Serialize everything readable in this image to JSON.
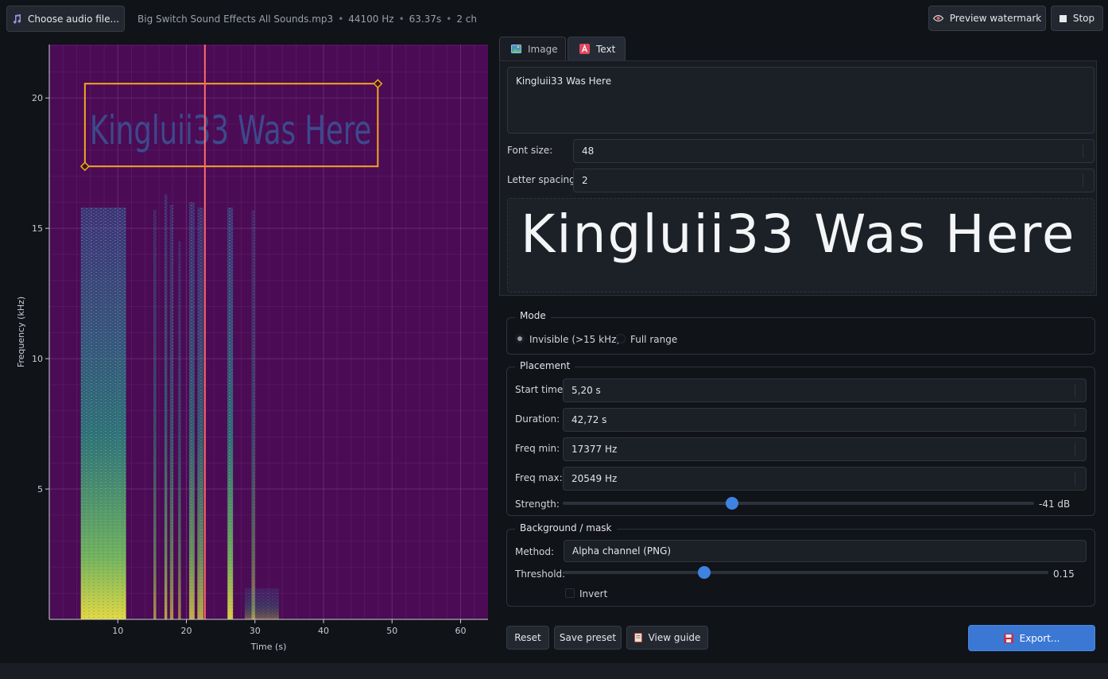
{
  "toolbar": {
    "choose_audio_label": "Choose audio file...",
    "file_name": "Big Switch Sound Effects All Sounds.mp3",
    "sample_rate": "44100 Hz",
    "duration": "63.37s",
    "channels": "2 ch",
    "separator": "•",
    "preview_label": "Preview watermark",
    "stop_label": "Stop"
  },
  "tabs": [
    {
      "label": "Image",
      "icon": "image-icon",
      "active": false
    },
    {
      "label": "Text",
      "icon": "text-icon",
      "active": true
    }
  ],
  "text_panel": {
    "watermark_text": "Kingluii33 Was Here",
    "font_size_label": "Font size:",
    "font_size_value": "48",
    "letter_spacing_label": "Letter spacing:",
    "letter_spacing_value": "2",
    "preview_text": "Kingluii33 Was Here"
  },
  "mode": {
    "title": "Mode",
    "options": [
      {
        "label": "Invisible (>15 kHz)",
        "selected": true
      },
      {
        "label": "Full range",
        "selected": false
      }
    ]
  },
  "placement": {
    "title": "Placement",
    "start_time_label": "Start time:",
    "start_time_value": "5,20 s",
    "duration_label": "Duration:",
    "duration_value": "42,72 s",
    "freq_min_label": "Freq min:",
    "freq_min_value": "17377 Hz",
    "freq_max_label": "Freq max:",
    "freq_max_value": "20549 Hz",
    "strength_label": "Strength:",
    "strength_value": "-41 dB",
    "strength_fraction": 0.36
  },
  "background": {
    "title": "Background / mask",
    "method_label": "Method:",
    "method_value": "Alpha channel (PNG)",
    "threshold_label": "Threshold:",
    "threshold_value": "0.15",
    "threshold_fraction": 0.29,
    "invert_label": "Invert",
    "invert_checked": false
  },
  "footer": {
    "reset_label": "Reset",
    "save_preset_label": "Save preset",
    "view_guide_label": "View guide",
    "export_label": "Export..."
  },
  "colors": {
    "accent": "#3a78d4",
    "spectrogram_bg": "#4b0b55",
    "playhead": "#ff6b6b",
    "selection": "#f5a623",
    "watermark_text": "#3c4a8c"
  },
  "chart_data": {
    "type": "heatmap",
    "title": "",
    "xlabel": "Time (s)",
    "ylabel": "Frequency (kHz)",
    "xlim": [
      0,
      64
    ],
    "ylim": [
      0,
      22.05
    ],
    "x_ticks": [
      10,
      20,
      30,
      40,
      50,
      60
    ],
    "y_ticks": [
      5,
      10,
      15,
      20
    ],
    "grid": true,
    "playhead_time": 22.7,
    "watermark_box": {
      "t_start": 5.2,
      "t_end": 47.92,
      "f_min": 17.377,
      "f_max": 20.549
    },
    "watermark_text": "Kingluii33 Was Here",
    "energy_bursts": [
      {
        "t_start": 4.6,
        "t_end": 11.2,
        "f_top": 15.8,
        "level": 0.95
      },
      {
        "t_start": 15.2,
        "t_end": 15.6,
        "f_top": 15.7,
        "level": 0.6
      },
      {
        "t_start": 16.8,
        "t_end": 17.2,
        "f_top": 16.3,
        "level": 0.7
      },
      {
        "t_start": 17.6,
        "t_end": 18.1,
        "f_top": 15.9,
        "level": 0.6
      },
      {
        "t_start": 18.8,
        "t_end": 19.2,
        "f_top": 14.5,
        "level": 0.55
      },
      {
        "t_start": 20.4,
        "t_end": 21.2,
        "f_top": 16.0,
        "level": 0.75
      },
      {
        "t_start": 21.6,
        "t_end": 22.5,
        "f_top": 15.8,
        "level": 0.7
      },
      {
        "t_start": 26.0,
        "t_end": 26.8,
        "f_top": 15.8,
        "level": 0.9
      },
      {
        "t_start": 29.5,
        "t_end": 30.0,
        "f_top": 15.7,
        "level": 0.5
      },
      {
        "t_start": 28.5,
        "t_end": 33.5,
        "f_top": 1.2,
        "level": 0.35
      }
    ]
  }
}
